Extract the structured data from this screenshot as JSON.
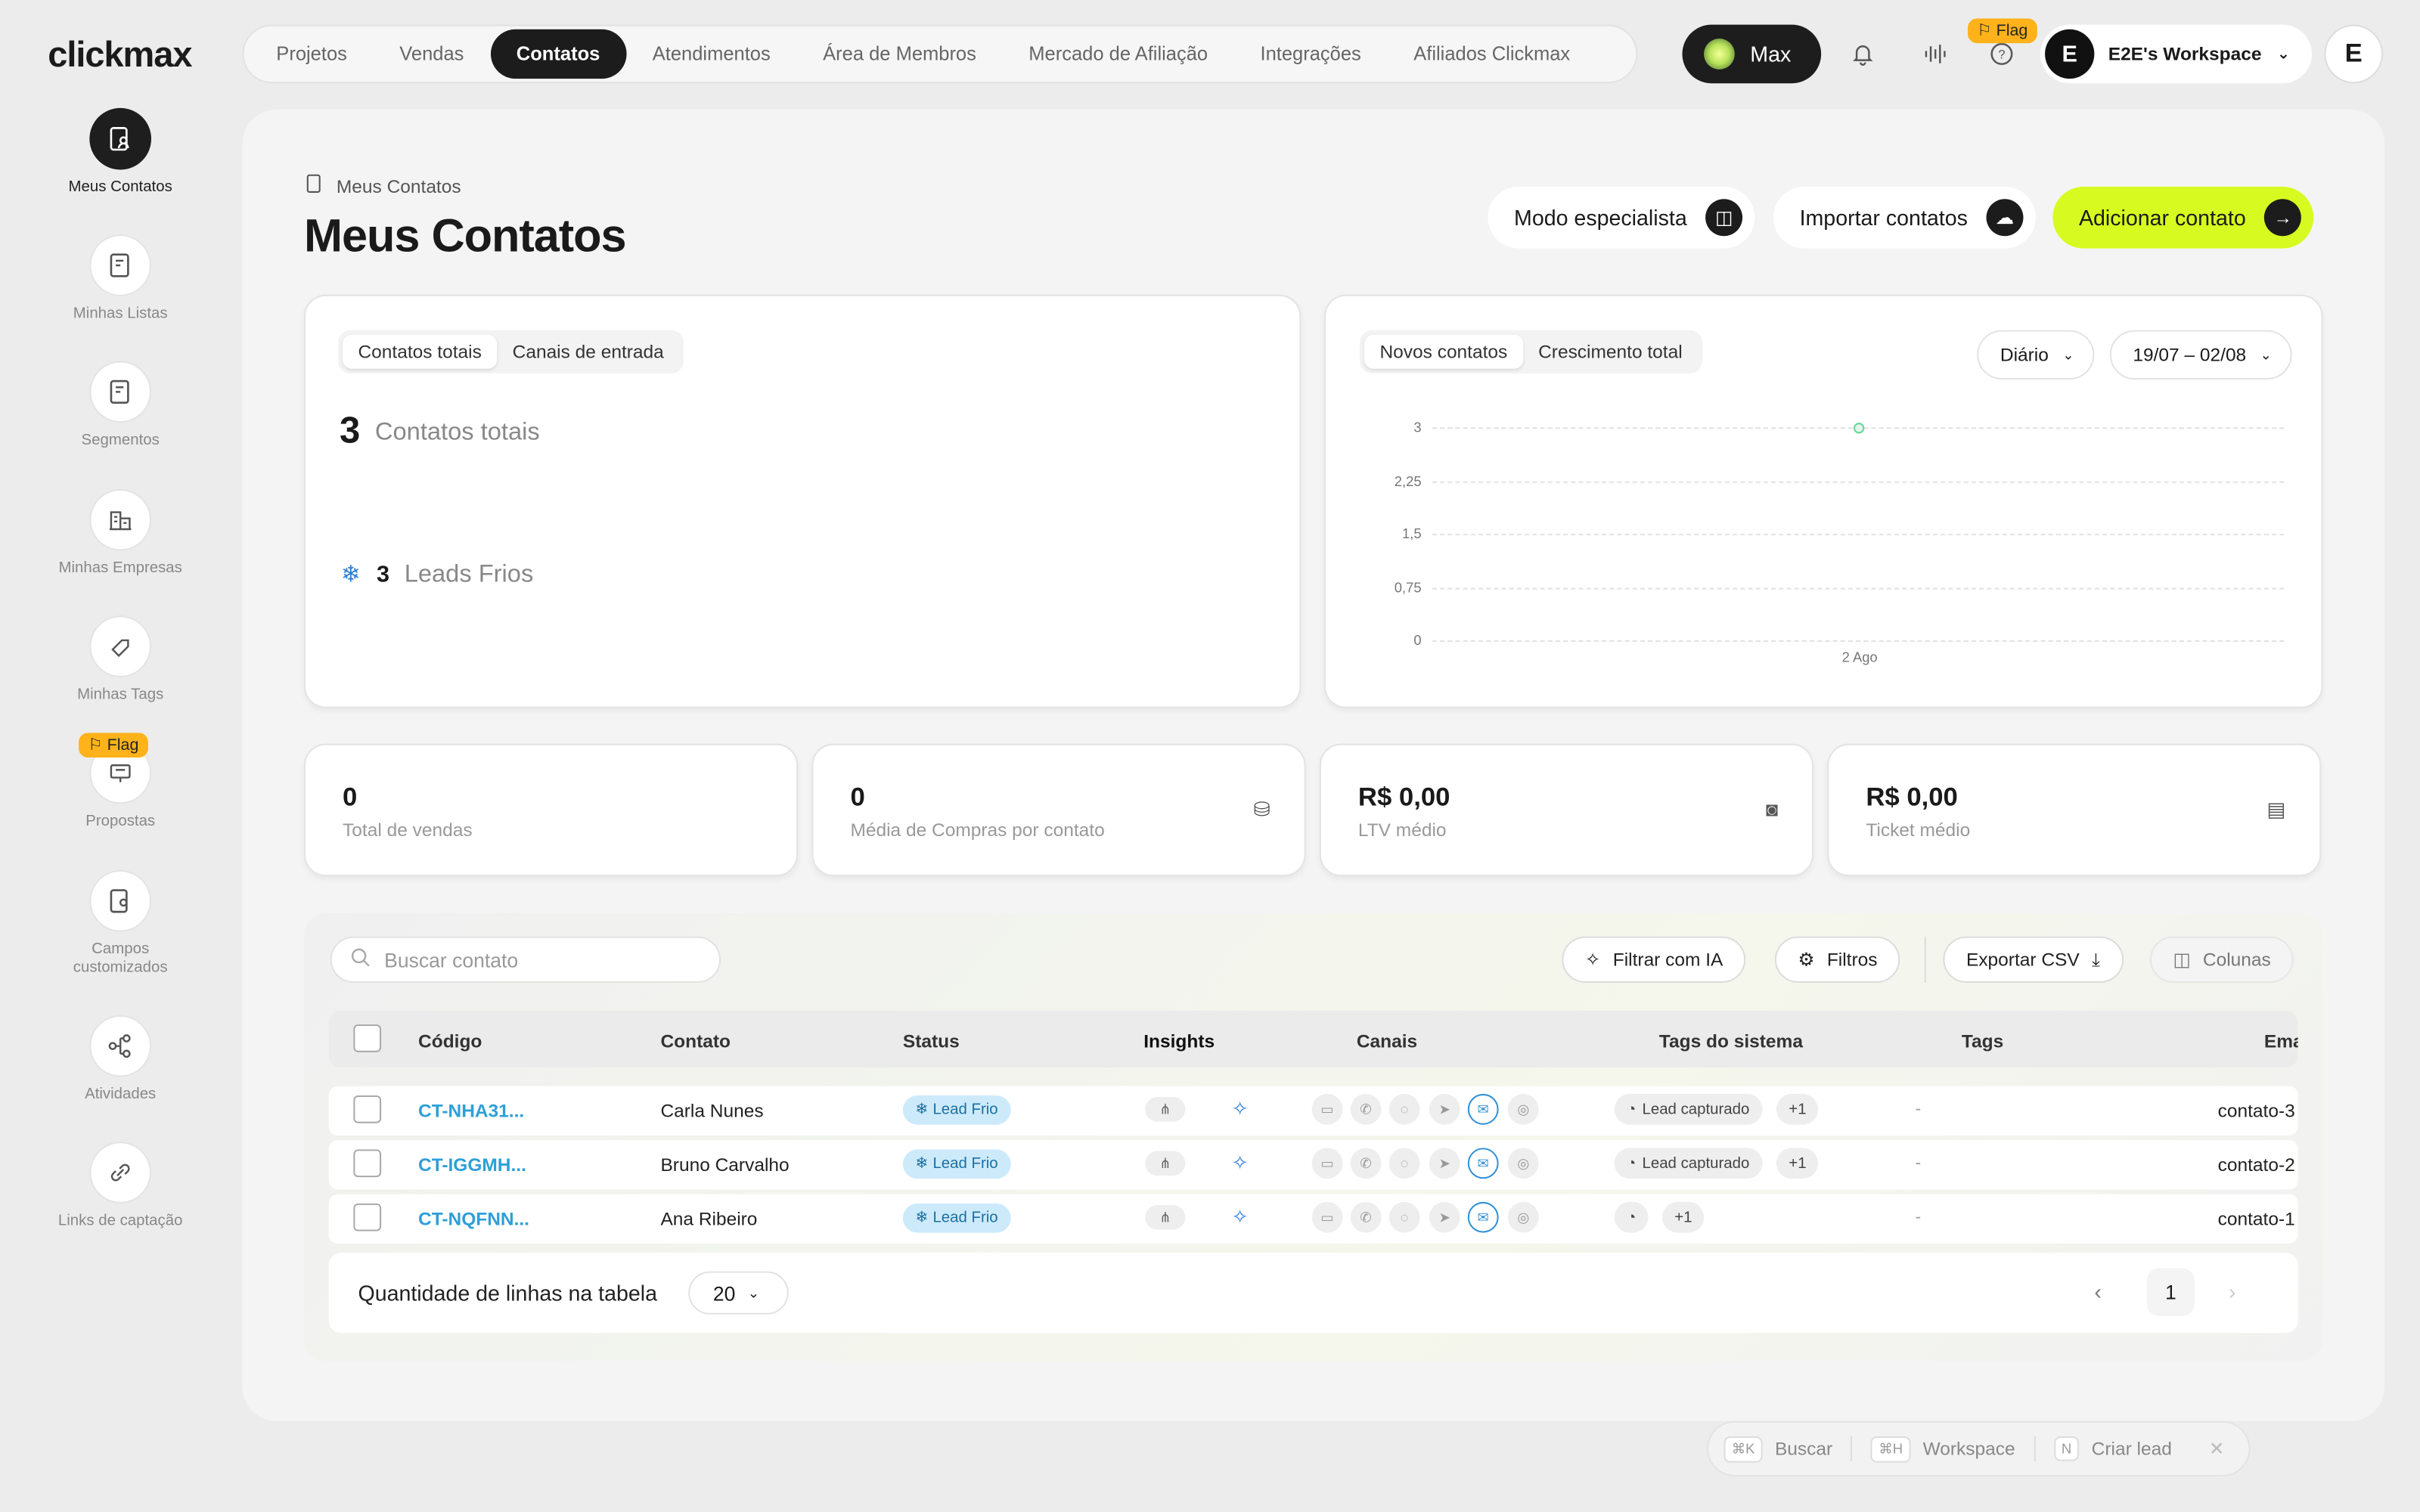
{
  "app": {
    "logo": "clickmax"
  },
  "topnav": [
    "Projetos",
    "Vendas",
    "Contatos",
    "Atendimentos",
    "Área de Membros",
    "Mercado de Afiliação",
    "Integrações",
    "Afiliados Clickmax"
  ],
  "top": {
    "max": "Max",
    "flag": "Flag",
    "workspace": "E2E's Workspace",
    "ws_initial": "E",
    "user_initial": "E"
  },
  "sidebar": [
    "Meus Contatos",
    "Minhas Listas",
    "Segmentos",
    "Minhas Empresas",
    "Minhas Tags",
    "Propostas",
    "Campos customizados",
    "Atividades",
    "Links de captação"
  ],
  "page": {
    "breadcrumb": "Meus Contatos",
    "title": "Meus Contatos",
    "btn_expert": "Modo especialista",
    "btn_import": "Importar contatos",
    "btn_add": "Adicionar contato"
  },
  "summary": {
    "tab1": "Contatos totais",
    "tab2": "Canais de entrada",
    "total": "3",
    "total_label": "Contatos totais",
    "cold": "3",
    "cold_label": "Leads Frios"
  },
  "growth": {
    "tab1": "Novos contatos",
    "tab2": "Crescimento total",
    "period": "Diário",
    "range": "19/07 – 02/08"
  },
  "chart_data": {
    "type": "line",
    "x": [
      "2 Ago"
    ],
    "series": [
      {
        "values": [
          3
        ]
      }
    ],
    "yticks": [
      "3",
      "2,25",
      "1,5",
      "0,75",
      "0"
    ],
    "ylim": [
      0,
      3
    ],
    "grid": true
  },
  "stats": [
    {
      "value": "0",
      "label": "Total de vendas"
    },
    {
      "value": "0",
      "label": "Média de Compras por contato"
    },
    {
      "value": "R$ 0,00",
      "label": "LTV médio"
    },
    {
      "value": "R$ 0,00",
      "label": "Ticket médio"
    }
  ],
  "table": {
    "search_placeholder": "Buscar contato",
    "btn_ai": "Filtrar com IA",
    "btn_filters": "Filtros",
    "btn_export": "Exportar CSV",
    "btn_columns": "Colunas",
    "headers": [
      "Código",
      "Contato",
      "Status",
      "Insights",
      "Canais",
      "Tags do sistema",
      "Tags",
      "Ema"
    ],
    "rows": [
      {
        "code": "CT-NHA31...",
        "name": "Carla Nunes",
        "status": "Lead Frio",
        "tag": "Lead capturado",
        "more": "+1",
        "tags": "-",
        "email": "contato-3"
      },
      {
        "code": "CT-IGGMH...",
        "name": "Bruno Carvalho",
        "status": "Lead Frio",
        "tag": "Lead capturado",
        "more": "+1",
        "tags": "-",
        "email": "contato-2"
      },
      {
        "code": "CT-NQFNN...",
        "name": "Ana Ribeiro",
        "status": "Lead Frio",
        "tag": "",
        "more": "+1",
        "tags": "-",
        "email": "contato-1"
      }
    ],
    "rows_label": "Quantidade de linhas na tabela",
    "rows_value": "20",
    "page": "1"
  },
  "shortcuts": [
    {
      "key": "⌘K",
      "label": "Buscar"
    },
    {
      "key": "⌘H",
      "label": "Workspace"
    },
    {
      "key": "N",
      "label": "Criar lead"
    }
  ]
}
